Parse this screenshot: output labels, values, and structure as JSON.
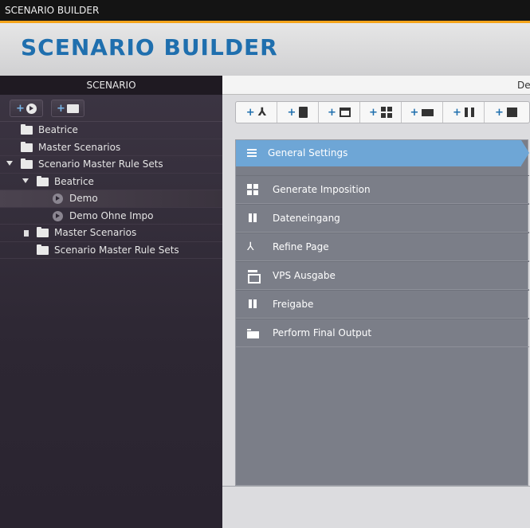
{
  "window": {
    "title": "SCENARIO BUILDER"
  },
  "header": {
    "title": "SCENARIO BUILDER"
  },
  "left_panel": {
    "title": "SCENARIO",
    "tree": [
      {
        "label": "Beatrice",
        "type": "folder",
        "level": 0,
        "expanded": false
      },
      {
        "label": "Master Scenarios",
        "type": "folder",
        "level": 0,
        "expanded": false
      },
      {
        "label": "Scenario Master Rule Sets",
        "type": "folder",
        "level": 0,
        "expanded": true
      },
      {
        "label": "Beatrice",
        "type": "folder",
        "level": 1,
        "expanded": true
      },
      {
        "label": "Demo",
        "type": "scenario",
        "level": 2,
        "selected": true
      },
      {
        "label": "Demo Ohne Impo",
        "type": "scenario",
        "level": 2
      },
      {
        "label": "Master Scenarios",
        "type": "folder",
        "level": 1,
        "expanded": false
      },
      {
        "label": "Scenario Master Rule Sets",
        "type": "folder",
        "level": 1
      }
    ]
  },
  "tab": {
    "label": "De"
  },
  "toolbar": {
    "actions": [
      {
        "plus": "+",
        "icon": "acrobat-icon"
      },
      {
        "plus": "+",
        "icon": "document-gear-icon"
      },
      {
        "plus": "+",
        "icon": "printer-icon"
      },
      {
        "plus": "+",
        "icon": "grid-icon"
      },
      {
        "plus": "+",
        "icon": "output-tray-icon"
      },
      {
        "plus": "+",
        "icon": "pause-icon"
      },
      {
        "plus": "+",
        "icon": "list-icon"
      }
    ]
  },
  "general_settings": {
    "label": "General Settings"
  },
  "steps": [
    {
      "label": "Generate Imposition",
      "icon": "grid-icon"
    },
    {
      "label": "Dateneingang",
      "icon": "pause-icon"
    },
    {
      "label": "Refine Page",
      "icon": "acrobat-icon"
    },
    {
      "label": "VPS Ausgabe",
      "icon": "printer-icon"
    },
    {
      "label": "Freigabe",
      "icon": "pause-icon"
    },
    {
      "label": "Perform Final Output",
      "icon": "output-tray-icon"
    }
  ],
  "colors": {
    "accent": "#f4a41a",
    "brand": "#1f6fae",
    "selected_step": "#6ea6d6"
  }
}
